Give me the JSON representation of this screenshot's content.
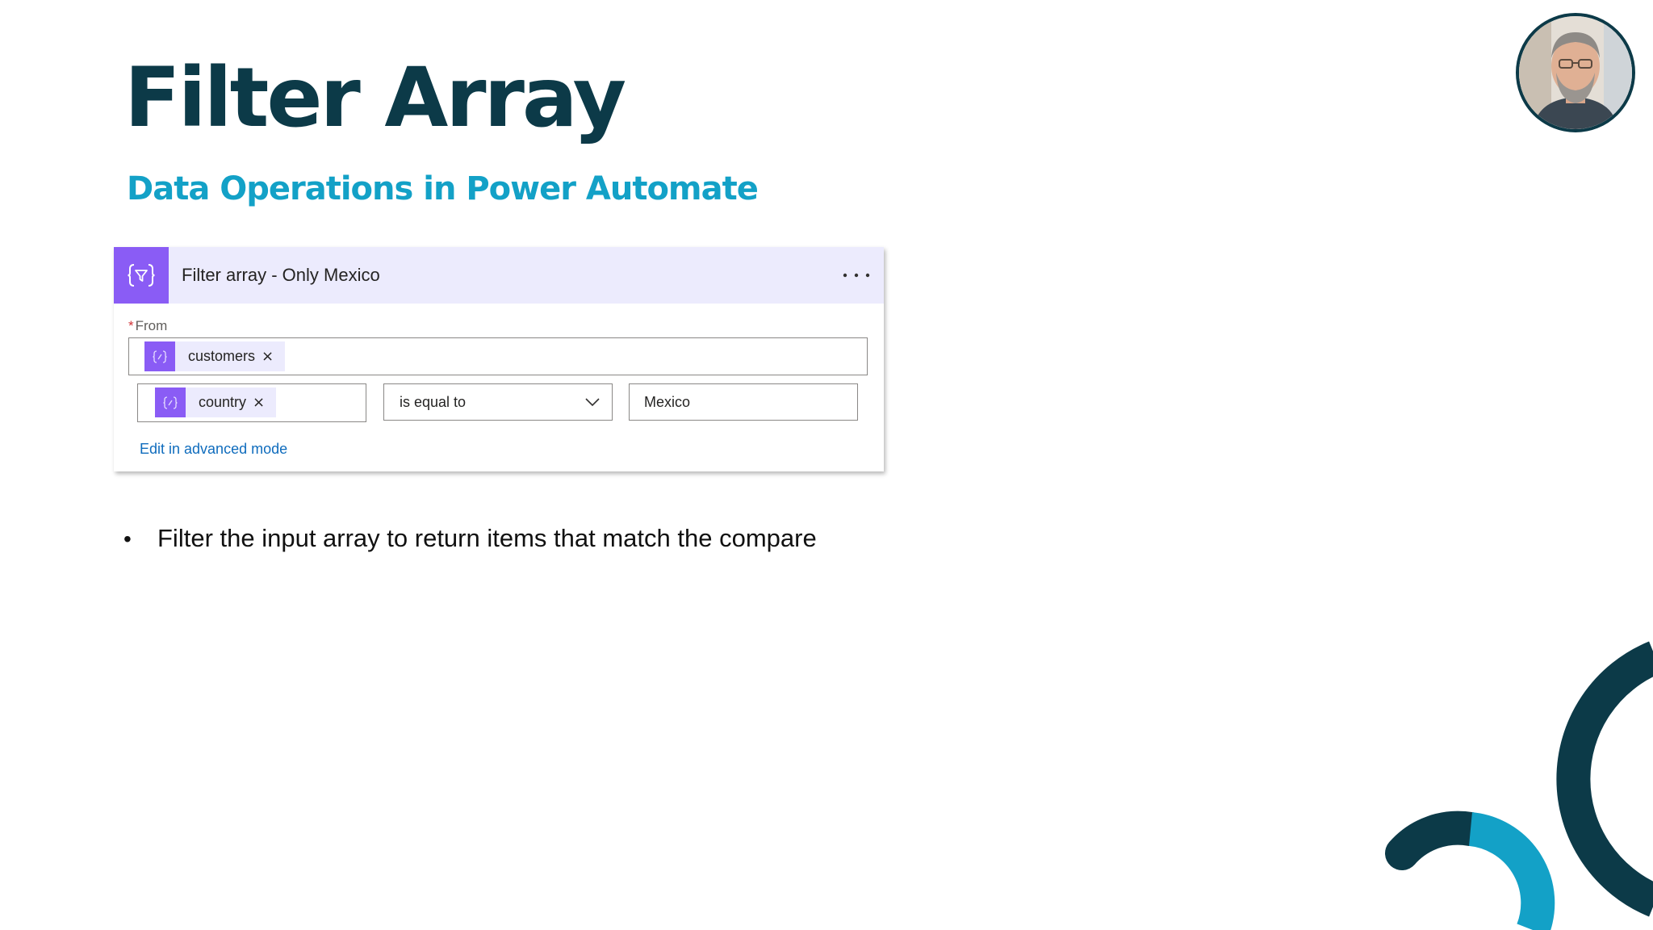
{
  "slide": {
    "title": "Filter Array",
    "subtitle": "Data Operations in Power Automate"
  },
  "action_card": {
    "title": "Filter array - Only Mexico",
    "menu_label": "• • •",
    "from_field": {
      "required_marker": "*",
      "label": "From",
      "token_label": "customers",
      "token_remove": "×"
    },
    "condition": {
      "left_token_label": "country",
      "left_token_remove": "×",
      "operator": "is equal to",
      "right_value": "Mexico"
    },
    "advanced_link": "Edit in advanced mode"
  },
  "bullets": [
    {
      "marker": "•",
      "text": "Filter the input array to return items that match the compare"
    }
  ],
  "colors": {
    "title": "#0c3a48",
    "subtitle": "#13a1c7",
    "action_accent": "#8a5cf5",
    "action_header_bg": "#ecebfd",
    "link": "#0f6cbd",
    "deco_dark": "#0c3a48",
    "deco_light": "#13a1c7"
  },
  "icons": {
    "action": "filter-braces-icon",
    "token": "expression-braces-icon",
    "menu": "more-options-icon",
    "dropdown": "chevron-down-icon"
  }
}
